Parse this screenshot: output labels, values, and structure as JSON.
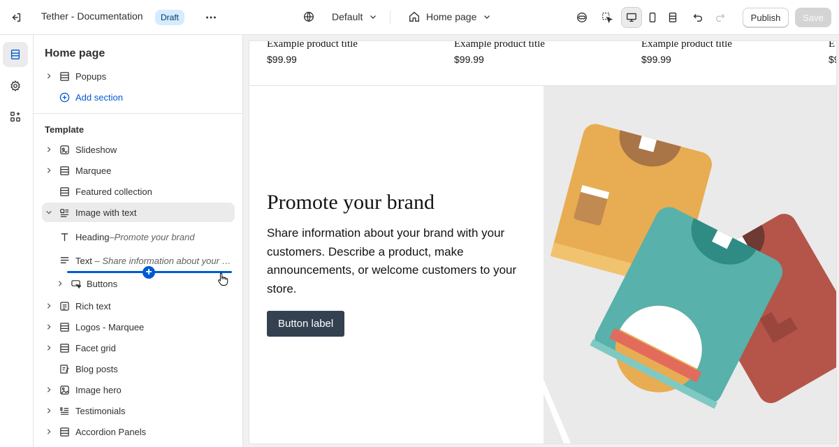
{
  "topbar": {
    "title": "Tether - Documentation",
    "badge": "Draft",
    "theme_dropdown": "Default",
    "page_dropdown": "Home page",
    "publish_label": "Publish",
    "save_label": "Save"
  },
  "panel": {
    "title": "Home page",
    "header_sections": [
      {
        "label": "Popups",
        "icon": "section-icon"
      }
    ],
    "add_section_label": "Add section",
    "template_label": "Template",
    "template_sections": [
      {
        "label": "Slideshow",
        "icon": "slideshow-icon"
      },
      {
        "label": "Marquee",
        "icon": "section-icon"
      },
      {
        "label": "Featured collection",
        "icon": "section-icon"
      },
      {
        "label": "Image with text",
        "icon": "image-text-icon"
      },
      {
        "label": "Heading",
        "sub": "Promote your brand",
        "icon": "heading-icon"
      },
      {
        "label": "Text",
        "sub": "Share information about your brand with your customers.",
        "icon": "text-icon"
      },
      {
        "label": "Buttons",
        "icon": "button-icon"
      },
      {
        "label": "Rich text",
        "icon": "richtext-icon"
      },
      {
        "label": "Logos - Marquee",
        "icon": "section-icon"
      },
      {
        "label": "Facet grid",
        "icon": "section-icon"
      },
      {
        "label": "Blog posts",
        "icon": "blog-icon"
      },
      {
        "label": "Image hero",
        "icon": "image-icon"
      },
      {
        "label": "Testimonials",
        "icon": "testimonial-icon"
      },
      {
        "label": "Accordion Panels",
        "icon": "section-icon"
      }
    ],
    "heading_separator": " – "
  },
  "preview": {
    "products": [
      {
        "title": "Example product title",
        "price": "$99.99"
      },
      {
        "title": "Example product title",
        "price": "$99.99"
      },
      {
        "title": "Example product title",
        "price": "$99.99"
      },
      {
        "title": "E",
        "price": "$9"
      }
    ],
    "iwt": {
      "heading": "Promote your brand",
      "body": "Share information about your brand with your customers. Describe a product, make announcements, or welcome customers to your store.",
      "button": "Button label"
    }
  },
  "colors": {
    "accent": "#005bd3",
    "button": "#334150",
    "shirt_orange": "#e8ad52",
    "shirt_teal": "#58b1aa",
    "shirt_red": "#b5554a"
  }
}
